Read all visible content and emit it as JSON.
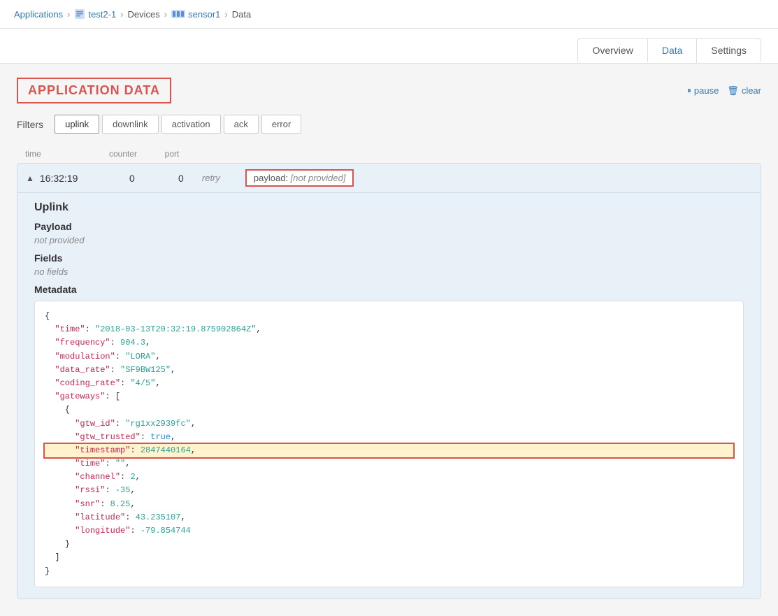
{
  "breadcrumb": {
    "applications": "Applications",
    "app_name": "test2-1",
    "devices": "Devices",
    "device_name": "sensor1",
    "page": "Data"
  },
  "page_nav": {
    "tabs": [
      {
        "id": "overview",
        "label": "Overview",
        "active": false
      },
      {
        "id": "data",
        "label": "Data",
        "active": true
      },
      {
        "id": "settings",
        "label": "Settings",
        "active": false
      }
    ]
  },
  "section": {
    "title": "APPLICATION DATA",
    "pause_label": "pause",
    "clear_label": "clear"
  },
  "filters": {
    "label": "Filters",
    "tabs": [
      {
        "id": "uplink",
        "label": "uplink",
        "active": true
      },
      {
        "id": "downlink",
        "label": "downlink",
        "active": false
      },
      {
        "id": "activation",
        "label": "activation",
        "active": false
      },
      {
        "id": "ack",
        "label": "ack",
        "active": false
      },
      {
        "id": "error",
        "label": "error",
        "active": false
      }
    ]
  },
  "table": {
    "headers": {
      "time": "time",
      "counter": "counter",
      "port": "port"
    },
    "rows": [
      {
        "time": "16:32:19",
        "counter": "0",
        "port": "0",
        "retry": "retry",
        "payload_label": "payload:",
        "payload_value": "[not provided]",
        "expanded": true,
        "section": "Uplink",
        "payload_section": "Payload",
        "payload_text": "not provided",
        "fields_section": "Fields",
        "fields_text": "no fields",
        "metadata_section": "Metadata",
        "json": {
          "time": "\"2018-03-13T20:32:19.875902864Z\"",
          "frequency": "904.3,",
          "modulation": "\"LORA\",",
          "data_rate": "\"SF9BW125\",",
          "coding_rate": "\"4/5\",",
          "gtw_id": "\"rg1xx2939fc\",",
          "gtw_trusted": "true,",
          "timestamp": "2847440164,",
          "time_inner": "\"\",",
          "channel": "2,",
          "rssi": "-35,",
          "snr": "8.25,",
          "latitude": "43.235107,",
          "longitude": "-79.854744"
        }
      }
    ]
  }
}
